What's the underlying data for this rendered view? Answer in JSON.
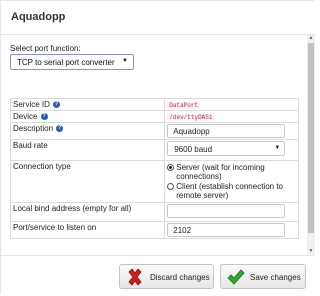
{
  "dialog": {
    "title": "Aquadopp"
  },
  "port": {
    "label": "Select port function:",
    "selected": "TCP to serial port converter"
  },
  "rows": {
    "service_id": {
      "label": "Service ID",
      "value": "DataPort"
    },
    "device": {
      "label": "Device",
      "value": "/dev/ttyDAS1"
    },
    "description": {
      "label": "Description",
      "value": "Aquadopp"
    },
    "baud_rate": {
      "label": "Baud rate",
      "value": "9600 baud"
    },
    "connection_type": {
      "label": "Connection type",
      "options": [
        {
          "label": "Server (wait for incoming connections)",
          "selected": true
        },
        {
          "label": "Client (establish connection to remote server)",
          "selected": false
        }
      ]
    },
    "bind_address": {
      "label": "Local bind address (empty for all)",
      "value": ""
    },
    "port_service": {
      "label": "Port/service to listen on",
      "value": "2102"
    }
  },
  "footer": {
    "discard_label": "Discard changes",
    "save_label": "Save changes"
  },
  "colors": {
    "discard_icon": "#cc1f1f",
    "save_icon": "#2ea82e",
    "info_icon": "#2a5db0"
  }
}
